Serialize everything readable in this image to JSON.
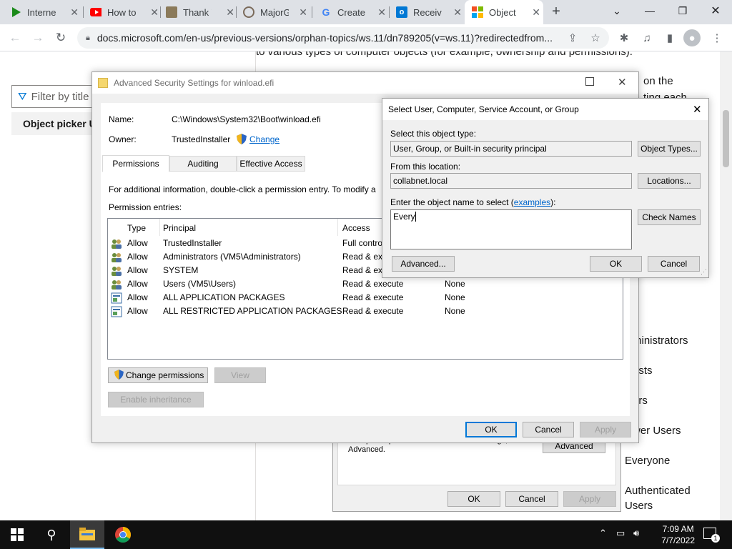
{
  "browser": {
    "tabs": [
      {
        "label": "Internet",
        "icon": "play-triangle-icon",
        "color": "#1a8a1a"
      },
      {
        "label": "How to",
        "icon": "youtube-icon",
        "color": "#ff0000"
      },
      {
        "label": "Thank Y",
        "icon": "tools-icon",
        "color": "#6b5b3e"
      },
      {
        "label": "MajorG",
        "icon": "gear-icon",
        "color": "#7a6a5a"
      },
      {
        "label": "Create",
        "icon": "google-icon",
        "color": "#4285f4"
      },
      {
        "label": "Receive",
        "icon": "outlook-icon",
        "color": "#0078d4"
      },
      {
        "label": "Object",
        "icon": "microsoft-icon",
        "color": "#f25022"
      }
    ],
    "new_tab": "+",
    "url": "docs.microsoft.com/en-us/previous-versions/orphan-topics/ws.11/dn789205(v=ws.11)?redirectedfrom..."
  },
  "page": {
    "filter_placeholder": "Filter by title",
    "nav_item": "Object picker U",
    "top_text": "to various types of computer objects (for example, ownership and permissions).",
    "side_snippets": [
      "on the",
      "ting each"
    ],
    "list_snippets": [
      "ministrators",
      "ests",
      "ers",
      "wer Users",
      "Everyone",
      "Authenticated",
      "Users"
    ]
  },
  "adv_dialog": {
    "title": "Advanced Security Settings for winload.efi",
    "name_label": "Name:",
    "name_value": "C:\\Windows\\System32\\Boot\\winload.efi",
    "owner_label": "Owner:",
    "owner_value": "TrustedInstaller",
    "change_link": "Change",
    "tabs": [
      "Permissions",
      "Auditing",
      "Effective Access"
    ],
    "info_text": "For additional information, double-click a permission entry. To modify a",
    "entries_label": "Permission entries:",
    "columns": [
      "Type",
      "Principal",
      "Access"
    ],
    "rows": [
      {
        "type": "Allow",
        "principal": "TrustedInstaller",
        "access": "Full control",
        "inherited": "",
        "icon": "users-icon"
      },
      {
        "type": "Allow",
        "principal": "Administrators (VM5\\Administrators)",
        "access": "Read & exe",
        "inherited": "",
        "icon": "users-icon"
      },
      {
        "type": "Allow",
        "principal": "SYSTEM",
        "access": "Read & exe",
        "inherited": "",
        "icon": "users-icon"
      },
      {
        "type": "Allow",
        "principal": "Users (VM5\\Users)",
        "access": "Read & execute",
        "inherited": "None",
        "icon": "users-icon"
      },
      {
        "type": "Allow",
        "principal": "ALL APPLICATION PACKAGES",
        "access": "Read & execute",
        "inherited": "None",
        "icon": "package-icon"
      },
      {
        "type": "Allow",
        "principal": "ALL RESTRICTED APPLICATION PACKAGES",
        "access": "Read & execute",
        "inherited": "None",
        "icon": "package-icon"
      }
    ],
    "change_permissions": "Change permissions",
    "view": "View",
    "enable_inheritance": "Enable inheritance",
    "ok": "OK",
    "cancel": "Cancel",
    "apply": "Apply"
  },
  "bg_dialog": {
    "hint": "For special permissions or advanced settings, click Advanced.",
    "advanced": "Advanced",
    "ok": "OK",
    "cancel": "Cancel",
    "apply": "Apply"
  },
  "select_dialog": {
    "title": "Select User, Computer, Service Account, or Group",
    "object_type_label": "Select this object type:",
    "object_type_value": "User, Group, or Built-in security principal",
    "object_types_btn": "Object Types...",
    "location_label": "From this location:",
    "location_value": "collabnet.local",
    "locations_btn": "Locations...",
    "enter_label_pre": "Enter the object name to select (",
    "examples_link": "examples",
    "enter_label_post": "):",
    "name_input": "Every",
    "check_names_btn": "Check Names",
    "advanced_btn": "Advanced...",
    "ok": "OK",
    "cancel": "Cancel"
  },
  "taskbar": {
    "time": "7:09 AM",
    "date": "7/7/2022",
    "notification_count": "1"
  }
}
